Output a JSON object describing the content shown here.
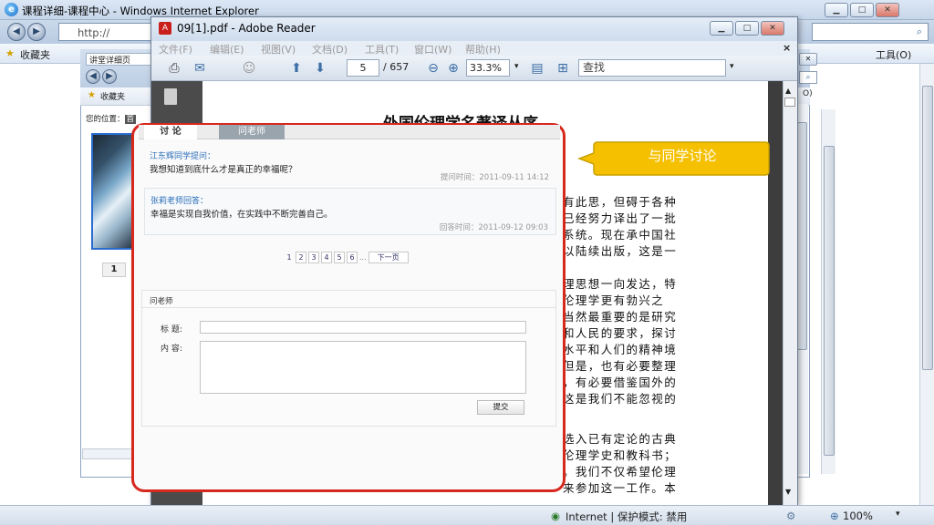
{
  "ie": {
    "title": "课程详细-课程中心 - Windows Internet Explorer",
    "url_partial": "http://",
    "favorites_label": "收藏夹",
    "tools_menu": "工具(O)",
    "status_zone": "Internet | 保护模式: 禁用",
    "zoom": "100%",
    "inner_tab_title": "讲堂详细页",
    "inner_favorites": "收藏夹",
    "inner_breadcrumb_prefix": "您的位置：",
    "inner_breadcrumb_first": "首",
    "inner_page_number": "1",
    "right_tools_short": "O)"
  },
  "reader": {
    "title": "09[1].pdf - Adobe Reader",
    "menu": [
      "文件(F)",
      "编辑(E)",
      "视图(V)",
      "文档(D)",
      "工具(T)",
      "窗口(W)",
      "帮助(H)"
    ],
    "current_page": "5",
    "total_pages": "/ 657",
    "zoom": "33.3%",
    "find_label": "查找",
    "book_title": "外国伦理学名著译丛序",
    "book_lines": [
      "有此思，但碍于各种",
      "已经努力译出了一批",
      "系统。现在承中国社",
      "以陆续出版，这是一",
      "",
      "理思想一向发达，特",
      "伦理学更有勃兴之",
      "当然最重要的是研究",
      "和人民的要求，探讨",
      "水平和人们的精神境",
      "但是，也有必要整理",
      "，有必要借鉴国外的",
      "这是我们不能忽视的",
      "",
      "选入已有定论的古典",
      "伦理学史和教科书；",
      "。我们不仅希望伦理",
      "来参加这一工作。本"
    ]
  },
  "discussion": {
    "tabs": [
      "讨 论",
      "问老师"
    ],
    "messages": [
      {
        "author": "江东辉同学提问：",
        "text": "我想知道到底什么才是真正的幸福呢？",
        "time": "提问时间：2011-09-11 14:12"
      },
      {
        "author": "张莉老师回答：",
        "text": "幸福是实现自我价值，在实践中不断完善自己。",
        "time": "回答时间：2011-09-12 09:03"
      }
    ],
    "pages": [
      "1",
      "2",
      "3",
      "4",
      "5",
      "6"
    ],
    "ellipsis": "...",
    "next_label": "下一页",
    "ask_header": "问老师",
    "subject_label": "标  题:",
    "content_label": "内  容:",
    "submit_label": "提交"
  },
  "callout": {
    "text": "与同学讨论",
    "color": "#f5c000"
  },
  "accent": {
    "highlight": "#d7281e"
  }
}
